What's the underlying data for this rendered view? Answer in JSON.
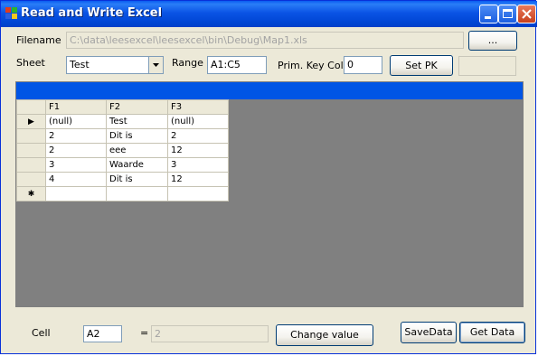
{
  "window": {
    "title": "Read and Write Excel"
  },
  "top": {
    "filename_label": "Filename",
    "filename_value": "C:\\data\\leesexcel\\leesexcel\\bin\\Debug\\Map1.xls",
    "browse_label": "...",
    "sheet_label": "Sheet",
    "sheet_value": "Test",
    "range_label": "Range",
    "range_value": "A1:C5",
    "pk_label": "Prim. Key Col",
    "pk_value": "0",
    "set_pk_label": "Set PK",
    "pk_status_value": ""
  },
  "grid": {
    "columns": [
      "F1",
      "F2",
      "F3"
    ],
    "current_row_marker": "▶",
    "new_row_marker": "✱",
    "rows": [
      [
        "(null)",
        "Test",
        "(null)"
      ],
      [
        "2",
        "Dit is",
        "2"
      ],
      [
        "2",
        "eee",
        "12"
      ],
      [
        "3",
        "Waarde",
        "3"
      ],
      [
        "4",
        "Dit is",
        "12"
      ]
    ]
  },
  "bottom": {
    "cell_label": "Cell",
    "cell_value": "A2",
    "equals": "=",
    "result_value": "2",
    "change_label": "Change value",
    "save_label": "SaveData",
    "get_label": "Get Data"
  },
  "colors": {
    "titlebar": "#0055e5",
    "grid_caption": "#0055e5",
    "grid_background": "#808080",
    "form_background": "#ece9d8"
  }
}
